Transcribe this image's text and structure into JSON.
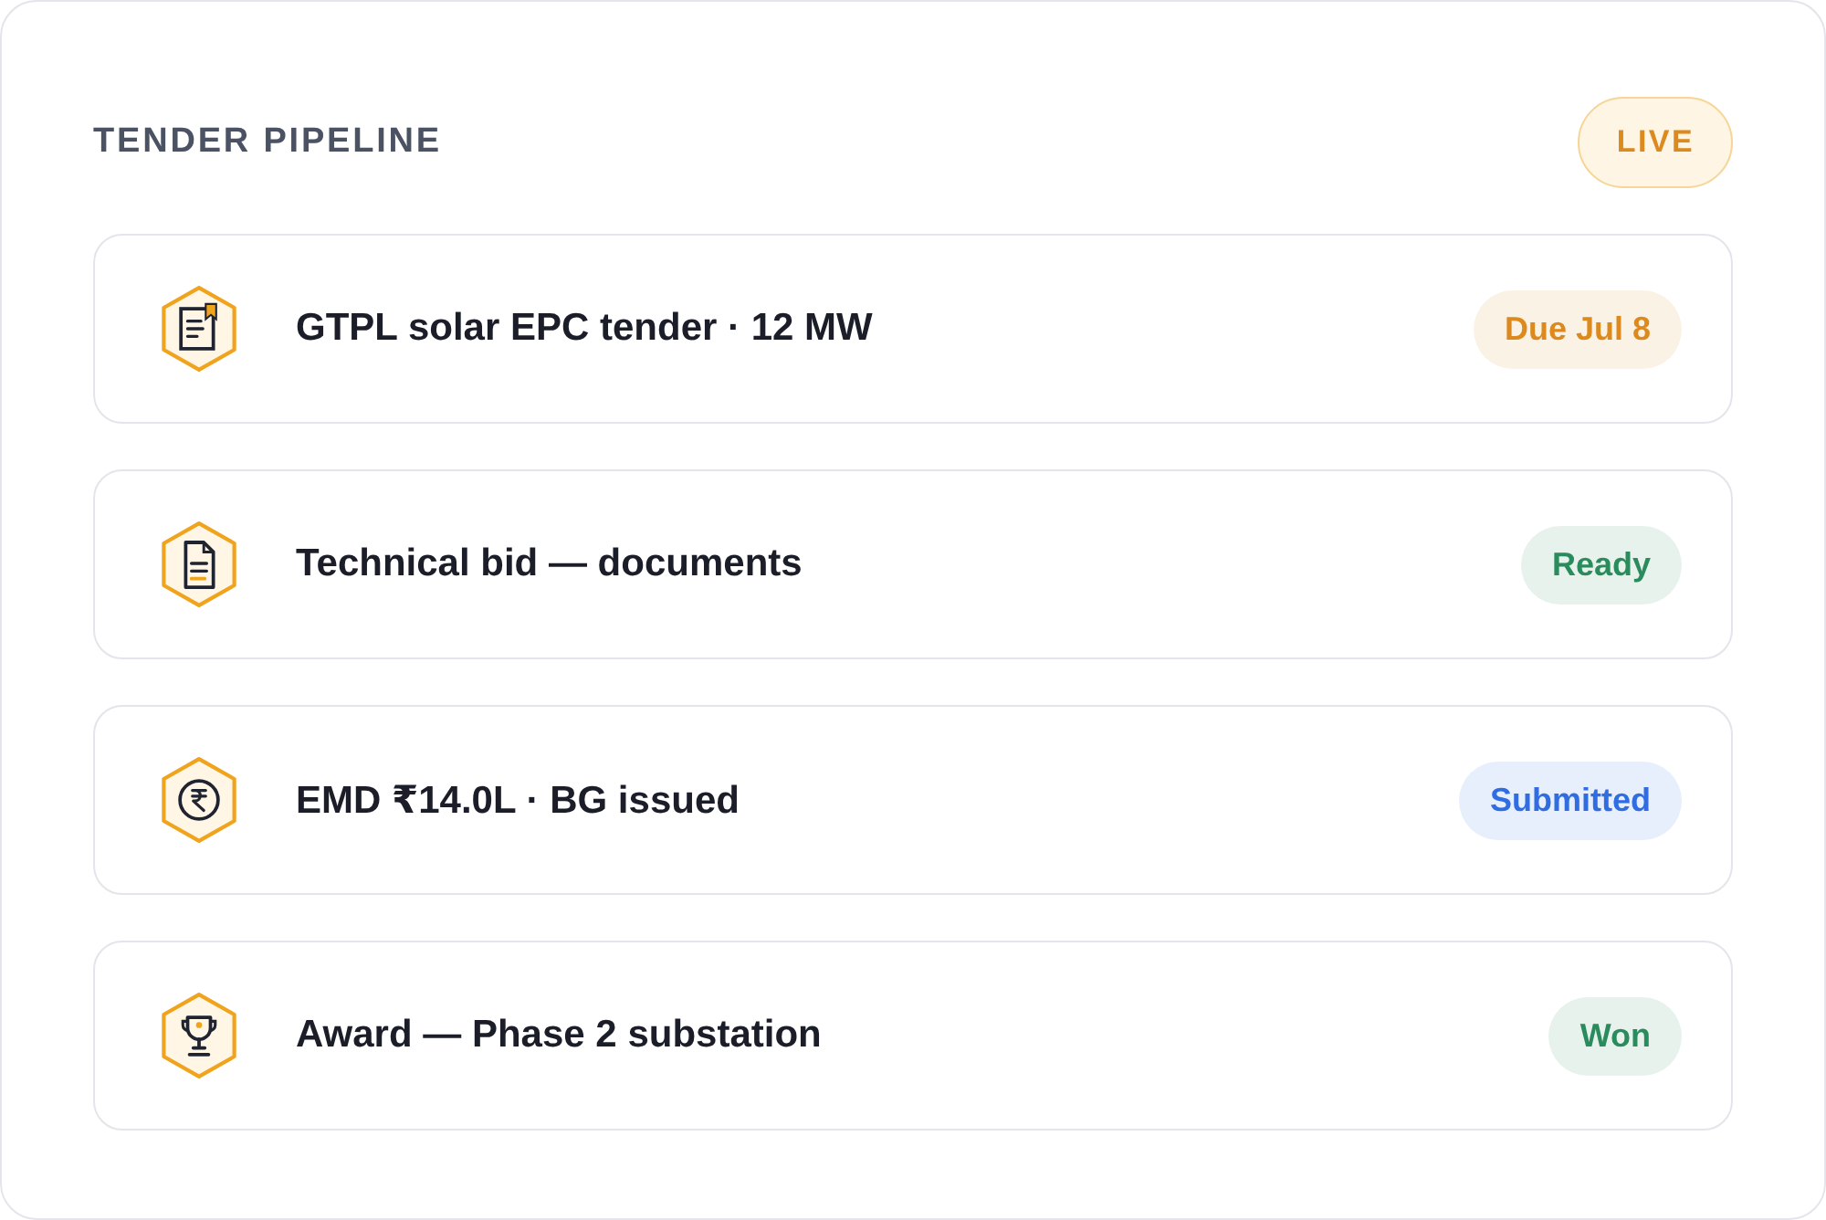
{
  "panel": {
    "title": "TENDER PIPELINE",
    "badge": {
      "label": "LIVE"
    }
  },
  "rows": [
    {
      "title": "GTPL solar EPC tender · 12 MW",
      "status": {
        "label": "Due Jul 8",
        "color": "#dc8a1e"
      }
    },
    {
      "title": "Technical bid — documents",
      "status": {
        "label": "Ready",
        "color": "#2a8c5c"
      }
    },
    {
      "title": "EMD ₹14.0L · BG issued",
      "status": {
        "label": "Submitted",
        "color": "#2f6de0"
      }
    },
    {
      "title": "Award — Phase 2 substation",
      "status": {
        "label": "Won",
        "color": "#2a8c5c"
      }
    }
  ]
}
